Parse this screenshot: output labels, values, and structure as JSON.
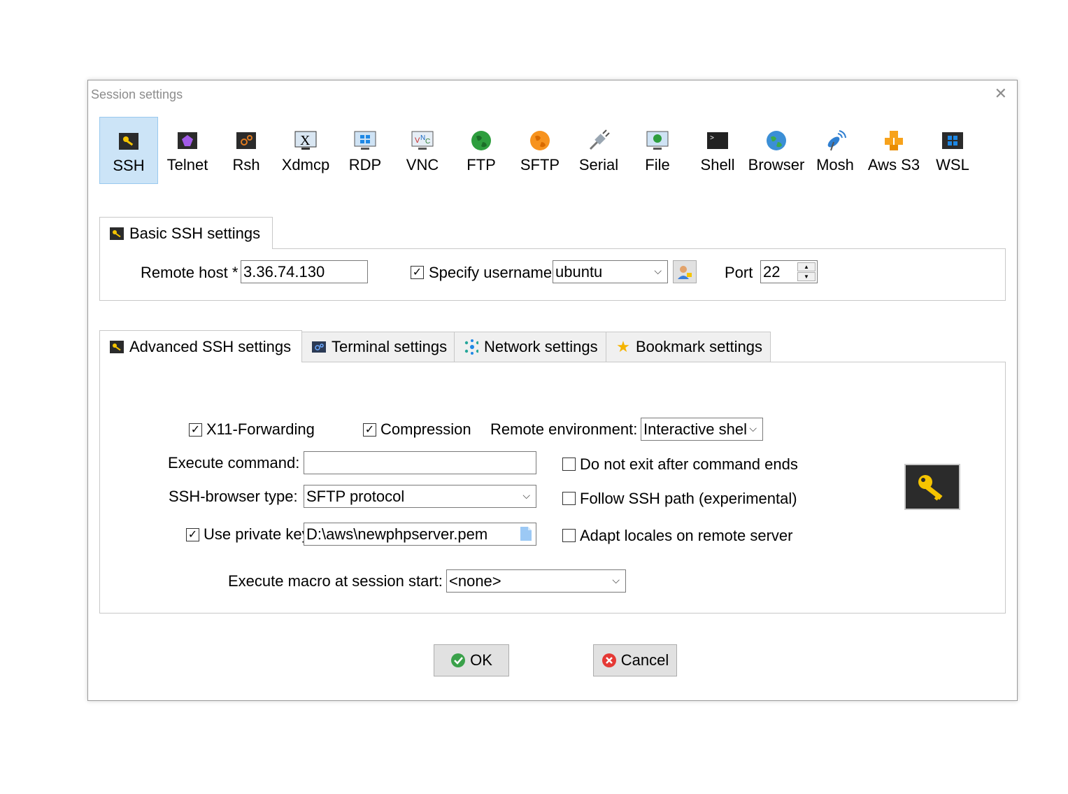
{
  "window": {
    "title": "Session settings",
    "close_icon": "close-icon"
  },
  "session_types": [
    {
      "label": "SSH",
      "icon": "ssh-key-icon",
      "selected": true
    },
    {
      "label": "Telnet",
      "icon": "telnet-icon"
    },
    {
      "label": "Rsh",
      "icon": "rsh-icon"
    },
    {
      "label": "Xdmcp",
      "icon": "xdmcp-icon"
    },
    {
      "label": "RDP",
      "icon": "rdp-icon"
    },
    {
      "label": "VNC",
      "icon": "vnc-icon"
    },
    {
      "label": "FTP",
      "icon": "ftp-globe-icon"
    },
    {
      "label": "SFTP",
      "icon": "sftp-globe-icon"
    },
    {
      "label": "Serial",
      "icon": "serial-plug-icon"
    },
    {
      "label": "File",
      "icon": "file-monitor-icon"
    },
    {
      "label": "Shell",
      "icon": "shell-terminal-icon"
    },
    {
      "label": "Browser",
      "icon": "browser-globe-icon"
    },
    {
      "label": "Mosh",
      "icon": "mosh-satellite-icon"
    },
    {
      "label": "Aws S3",
      "icon": "aws-s3-icon"
    },
    {
      "label": "WSL",
      "icon": "wsl-windows-icon"
    }
  ],
  "basic": {
    "tab_label": "Basic SSH settings",
    "remote_host_label": "Remote host *",
    "remote_host_value": "3.36.74.130",
    "specify_username_label": "Specify username",
    "specify_username_checked": true,
    "username_value": "ubuntu",
    "port_label": "Port",
    "port_value": "22"
  },
  "advanced_tabs": [
    {
      "label": "Advanced SSH settings",
      "icon": "key-icon",
      "active": true
    },
    {
      "label": "Terminal settings",
      "icon": "terminal-icon"
    },
    {
      "label": "Network settings",
      "icon": "network-icon"
    },
    {
      "label": "Bookmark settings",
      "icon": "star-icon"
    }
  ],
  "advanced": {
    "x11_label": "X11-Forwarding",
    "x11_checked": true,
    "compression_label": "Compression",
    "compression_checked": true,
    "remote_env_label": "Remote environment:",
    "remote_env_value": "Interactive shel",
    "execute_command_label": "Execute command:",
    "execute_command_value": "",
    "do_not_exit_label": "Do not exit after command ends",
    "ssh_browser_label": "SSH-browser type:",
    "ssh_browser_value": "SFTP protocol",
    "follow_path_label": "Follow SSH path (experimental)",
    "private_key_label": "Use private key",
    "private_key_checked": true,
    "private_key_value": "D:\\aws\\newphpserver.pem",
    "adapt_locales_label": "Adapt locales on remote server",
    "macro_label": "Execute macro at session start:",
    "macro_value": "<none>"
  },
  "buttons": {
    "ok": "OK",
    "cancel": "Cancel"
  }
}
